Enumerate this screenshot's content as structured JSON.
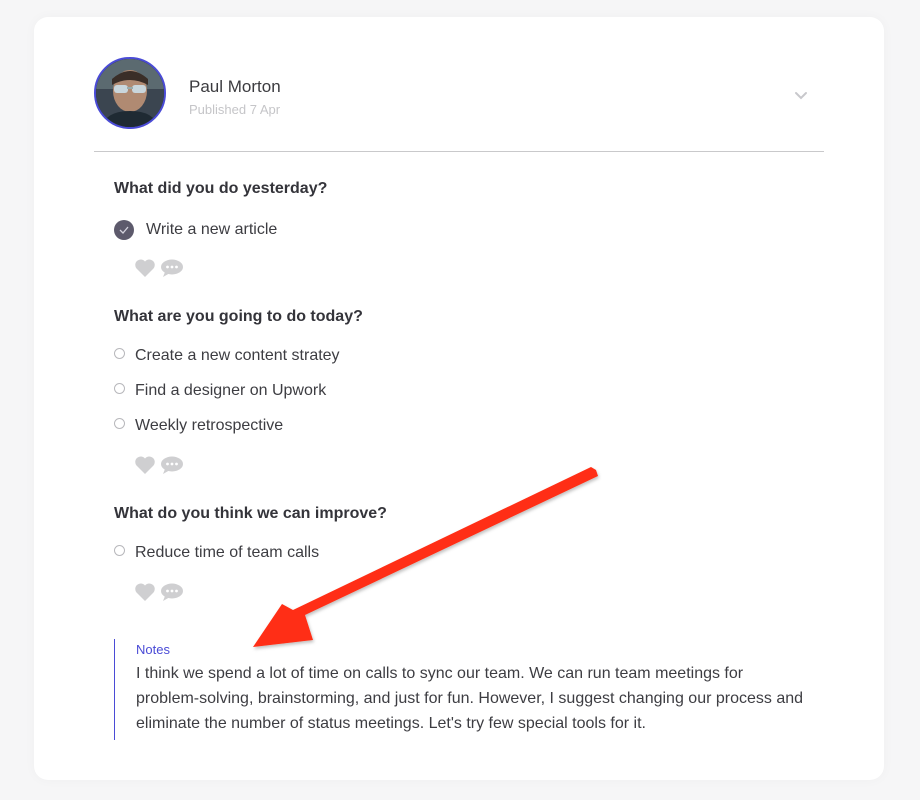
{
  "post": {
    "author": "Paul Morton",
    "published": "Published 7 Apr",
    "accent_color": "#4a4bd6"
  },
  "sections": [
    {
      "title": "What did you do yesterday?",
      "items": [
        {
          "label": "Write a new article",
          "checked": true
        }
      ]
    },
    {
      "title": "What are you going to do today?",
      "items": [
        {
          "label": "Create a new content stratey",
          "checked": false
        },
        {
          "label": "Find a designer on Upwork",
          "checked": false
        },
        {
          "label": "Weekly retrospective",
          "checked": false
        }
      ]
    },
    {
      "title": "What do you think we can improve?",
      "items": [
        {
          "label": "Reduce time of team calls",
          "checked": false
        }
      ]
    }
  ],
  "notes": {
    "label": "Notes",
    "text": "I think we spend a lot of time on calls to sync our team. We can run team meetings for problem-solving, brainstorming, and just for fun. However, I suggest changing our process and eliminate the number of status meetings. Let's try few special tools for it."
  },
  "annotation": {
    "arrow_color": "#ff2d12"
  }
}
